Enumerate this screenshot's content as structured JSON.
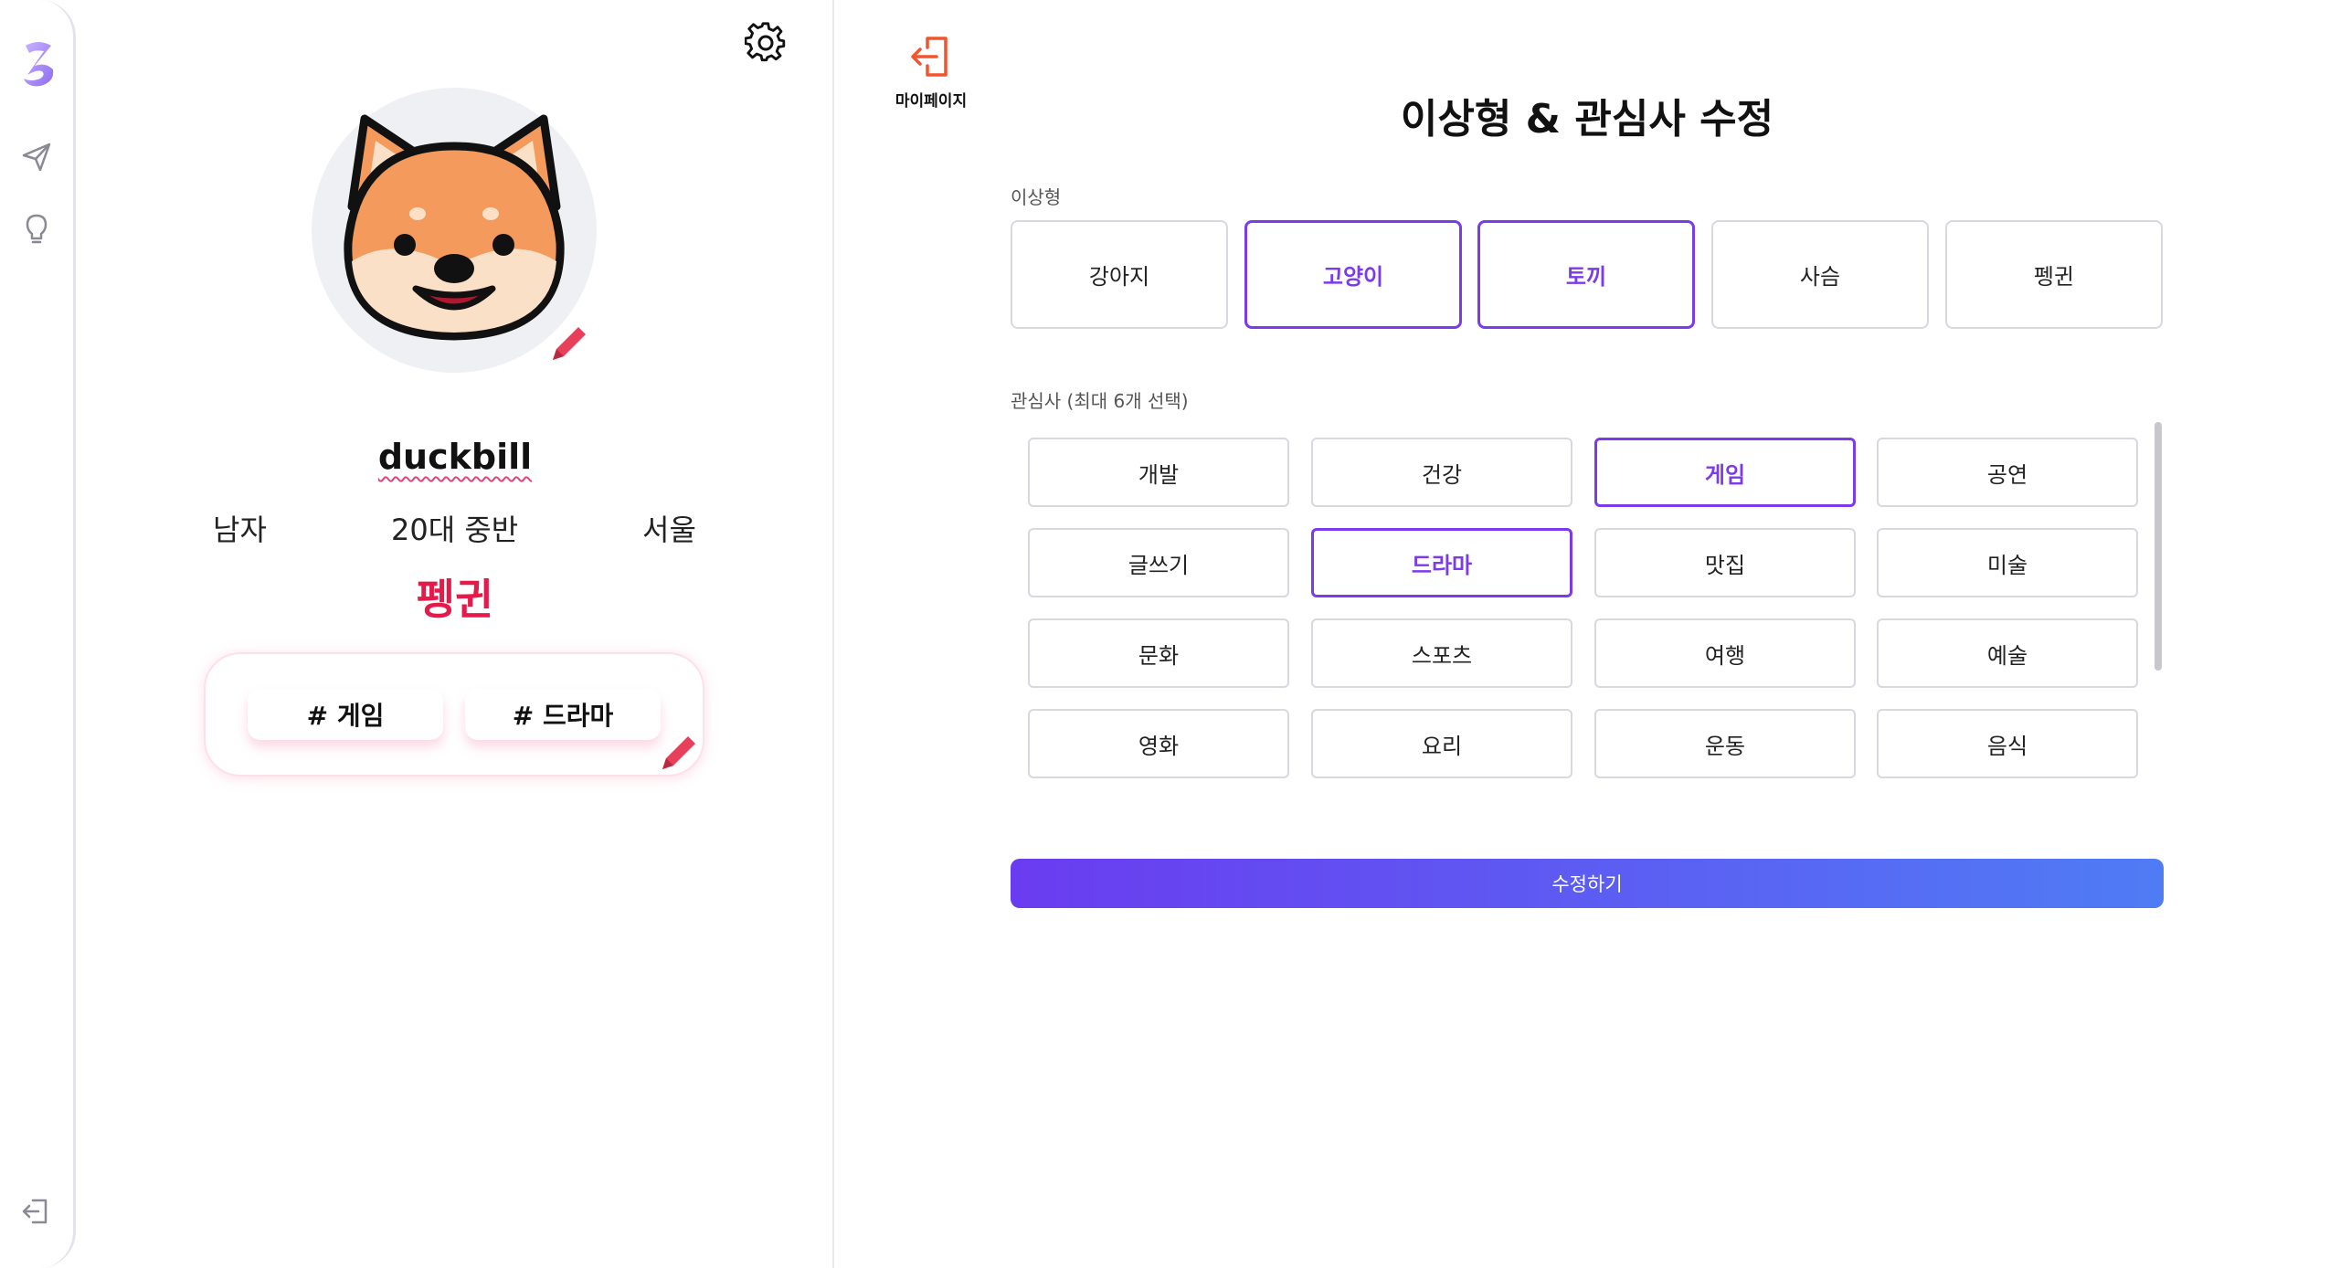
{
  "sidebar": {
    "icons": [
      "logo-z-icon",
      "send-icon",
      "lightbulb-icon",
      "logout-icon"
    ]
  },
  "profile": {
    "username": "duckbill",
    "gender": "남자",
    "age": "20대 중반",
    "region": "서울",
    "ideal_type": "펭귄",
    "tags": [
      "# 게임",
      "# 드라마"
    ],
    "avatar": "shiba-dog-avatar"
  },
  "editor": {
    "back_label": "마이페이지",
    "title": "이상형 & 관심사 수정",
    "ideal_section_label": "이상형",
    "ideal_options": [
      {
        "label": "강아지",
        "selected": false
      },
      {
        "label": "고양이",
        "selected": true
      },
      {
        "label": "토끼",
        "selected": true
      },
      {
        "label": "사슴",
        "selected": false
      },
      {
        "label": "펭귄",
        "selected": false
      }
    ],
    "interest_section_label": "관심사 (최대 6개 선택)",
    "interests": [
      {
        "label": "개발",
        "selected": false
      },
      {
        "label": "건강",
        "selected": false
      },
      {
        "label": "게임",
        "selected": true
      },
      {
        "label": "공연",
        "selected": false
      },
      {
        "label": "글쓰기",
        "selected": false
      },
      {
        "label": "드라마",
        "selected": true
      },
      {
        "label": "맛집",
        "selected": false
      },
      {
        "label": "미술",
        "selected": false
      },
      {
        "label": "문화",
        "selected": false
      },
      {
        "label": "스포츠",
        "selected": false
      },
      {
        "label": "여행",
        "selected": false
      },
      {
        "label": "예술",
        "selected": false
      },
      {
        "label": "영화",
        "selected": false
      },
      {
        "label": "요리",
        "selected": false
      },
      {
        "label": "운동",
        "selected": false
      },
      {
        "label": "음식",
        "selected": false
      }
    ],
    "submit_label": "수정하기"
  },
  "colors": {
    "accent": "#7c3aed",
    "ideal_text": "#e6194b",
    "submit_gradient_start": "#6a3cf0",
    "submit_gradient_end": "#4f7cf5",
    "back_icon": "#f2542d"
  }
}
